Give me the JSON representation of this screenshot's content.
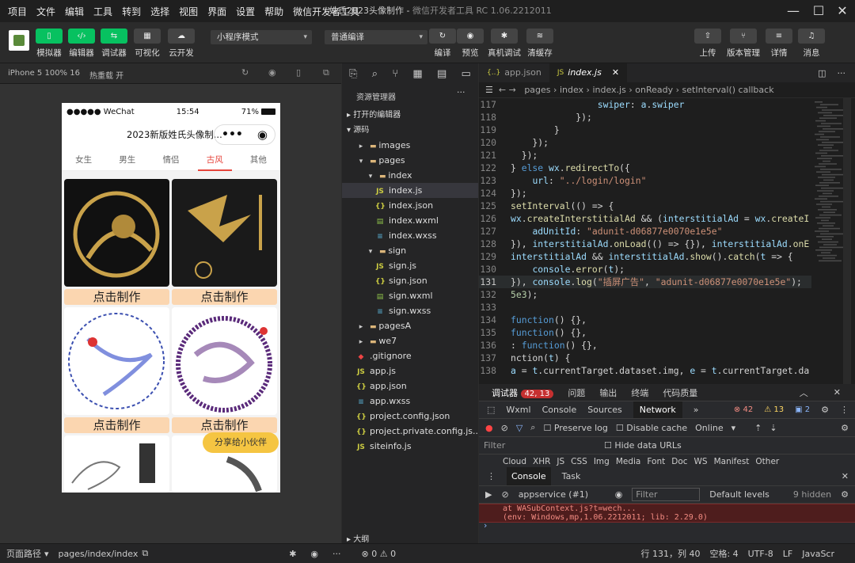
{
  "window": {
    "title": "姓氏2023头像制作",
    "subtitle": "微信开发者工具 RC 1.06.2212011"
  },
  "menu": [
    "项目",
    "文件",
    "编辑",
    "工具",
    "转到",
    "选择",
    "视图",
    "界面",
    "设置",
    "帮助",
    "微信开发者工具"
  ],
  "toolbar": {
    "left": [
      {
        "icon": "phone-icon",
        "label": "模拟器"
      },
      {
        "icon": "code-icon",
        "label": "编辑器"
      },
      {
        "icon": "debug-icon",
        "label": "调试器"
      },
      {
        "icon": "visual-icon",
        "label": "可视化"
      },
      {
        "icon": "cloud-icon",
        "label": "云开发"
      }
    ],
    "mode": "小程序模式",
    "compile": "普通编译",
    "middle": [
      {
        "icon": "refresh-icon",
        "label": "编译"
      },
      {
        "icon": "eye-icon",
        "label": "预览"
      },
      {
        "icon": "bug-icon",
        "label": "真机调试"
      },
      {
        "icon": "layers-icon",
        "label": "清缓存"
      }
    ],
    "right": [
      {
        "icon": "upload-icon",
        "label": "上传"
      },
      {
        "icon": "branch-icon",
        "label": "版本管理"
      },
      {
        "icon": "list-icon",
        "label": "详情"
      },
      {
        "icon": "bell-icon",
        "label": "消息"
      }
    ]
  },
  "simulator": {
    "device": "iPhone 5 100% 16",
    "hotreload": "热重载 开"
  },
  "phone": {
    "carrier": "●●●●● WeChat",
    "time": "15:54",
    "battery": "71%",
    "title": "2023新版姓氏头像制...",
    "tabs": [
      "女生",
      "男生",
      "情侣",
      "古风",
      "其他"
    ],
    "active_tab": "古风",
    "make": "点击制作",
    "share": "分享给小伙伴"
  },
  "explorer": {
    "title": "资源管理器",
    "open_editors": "打开的编辑器",
    "source": "源码",
    "outline": "大纲",
    "items": [
      {
        "name": "images",
        "type": "folder"
      },
      {
        "name": "pages",
        "type": "folder"
      },
      {
        "name": "index",
        "type": "folder"
      },
      {
        "name": "index.js",
        "type": "js"
      },
      {
        "name": "index.json",
        "type": "json"
      },
      {
        "name": "index.wxml",
        "type": "wxml"
      },
      {
        "name": "index.wxss",
        "type": "wxss"
      },
      {
        "name": "sign",
        "type": "folder"
      },
      {
        "name": "sign.js",
        "type": "js"
      },
      {
        "name": "sign.json",
        "type": "json"
      },
      {
        "name": "sign.wxml",
        "type": "wxml"
      },
      {
        "name": "sign.wxss",
        "type": "wxss"
      },
      {
        "name": "pagesA",
        "type": "folder"
      },
      {
        "name": "we7",
        "type": "folder"
      },
      {
        "name": ".gitignore",
        "type": "git"
      },
      {
        "name": "app.js",
        "type": "js"
      },
      {
        "name": "app.json",
        "type": "json"
      },
      {
        "name": "app.wxss",
        "type": "wxss"
      },
      {
        "name": "project.config.json",
        "type": "json"
      },
      {
        "name": "project.private.config.js...",
        "type": "json"
      },
      {
        "name": "siteinfo.js",
        "type": "js"
      }
    ]
  },
  "editor": {
    "tabs": [
      "app.json",
      "index.js"
    ],
    "active_tab": "index.js",
    "breadcrumb": [
      "pages",
      "index",
      "index.js",
      "onReady",
      "setInterval() callback"
    ],
    "lines": [
      {
        "n": "117",
        "t": "                swiper: a.swiper"
      },
      {
        "n": "118",
        "t": "            });"
      },
      {
        "n": "119",
        "t": "        }"
      },
      {
        "n": "120",
        "t": "    });"
      },
      {
        "n": "121",
        "t": "  });"
      },
      {
        "n": "122",
        "t": "} else wx.redirectTo({"
      },
      {
        "n": "123",
        "t": "    url: \"../login/login\""
      },
      {
        "n": "124",
        "t": "});"
      },
      {
        "n": "125",
        "t": "setInterval(() => {"
      },
      {
        "n": "126",
        "t": "wx.createInterstitialAd && (interstitialAd = wx.createI"
      },
      {
        "n": "127",
        "t": "    adUnitId: \"adunit-d06877e0070e1e5e\""
      },
      {
        "n": "128",
        "t": "}), interstitialAd.onLoad(() => {}), interstitialAd.onE"
      },
      {
        "n": "129",
        "t": "interstitialAd && interstitialAd.show().catch(t => {"
      },
      {
        "n": "130",
        "t": "    console.error(t);"
      },
      {
        "n": "131",
        "t": "}), console.log(\"插屏广告\", \"adunit-d06877e0070e1e5e\");"
      },
      {
        "n": "132",
        "t": "5e3);"
      },
      {
        "n": "133",
        "t": ""
      },
      {
        "n": "134",
        "t": "function() {},"
      },
      {
        "n": "135",
        "t": "function() {},"
      },
      {
        "n": "136",
        "t": ": function() {},"
      },
      {
        "n": "137",
        "t": "nction(t) {"
      },
      {
        "n": "138",
        "t": "a = t.currentTarget.dataset.img, e = t.currentTarget.da"
      }
    ]
  },
  "devtools": {
    "tabs": [
      "调试器",
      "问题",
      "输出",
      "终端",
      "代码质量"
    ],
    "badge": "42, 13",
    "panels": [
      "Wxml",
      "Console",
      "Sources",
      "Network"
    ],
    "active_panel": "Network",
    "errors": "42",
    "warnings": "13",
    "info": "2",
    "preserve_log": "Preserve log",
    "disable_cache": "Disable cache",
    "throttle": "Online",
    "filter": "Filter",
    "hide_data": "Hide data URLs",
    "types": [
      "Cloud",
      "XHR",
      "JS",
      "CSS",
      "Img",
      "Media",
      "Font",
      "Doc",
      "WS",
      "Manifest",
      "Other"
    ],
    "drawer_tabs": [
      "Console",
      "Task"
    ],
    "context": "appservice (#1)",
    "filter_ph": "Filter",
    "levels": "Default levels",
    "hidden": "9 hidden",
    "log1": "at WASubContext.js?t=wech...",
    "log2": "(env: Windows,mp,1.06.2212011; lib: 2.29.0)"
  },
  "status": {
    "path_label": "页面路径",
    "path": "pages/index/index",
    "problems": "⊗ 0 ⚠ 0",
    "pos": "行 131，列 40",
    "spaces": "空格: 4",
    "enc": "UTF-8",
    "eol": "LF",
    "lang": "JavaScr"
  }
}
